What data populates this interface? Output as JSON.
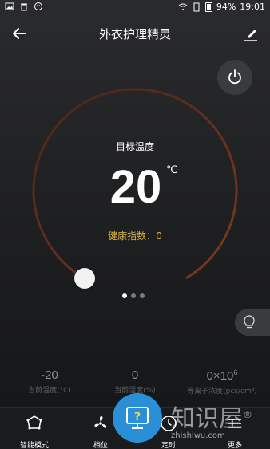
{
  "status_bar": {
    "battery": "94%",
    "time": "19:01"
  },
  "header": {
    "title": "外衣护理精灵"
  },
  "dial": {
    "label": "目标温度",
    "temperature": "20",
    "unit": "℃",
    "health_label": "健康指数：",
    "health_value": "0",
    "arc_color": "#6a2e1a"
  },
  "pager": {
    "count": 3,
    "active": 0
  },
  "stats": [
    {
      "value": "-20",
      "label": "当前温度(°C)"
    },
    {
      "value": "0",
      "label": "当前湿度(%)"
    },
    {
      "value": "0×10",
      "exp": "6",
      "label": "等离子浓度(pcs/cm³)"
    }
  ],
  "nav": [
    {
      "label": "智能模式",
      "icon": "smart-mode-icon"
    },
    {
      "label": "档位",
      "icon": "fan-icon"
    },
    {
      "label": "定时",
      "icon": "clock-icon"
    },
    {
      "label": "更多",
      "icon": "more-icon"
    }
  ],
  "watermark": {
    "text": "知识屋",
    "reg": "®",
    "sub": "zhishiwu.com"
  },
  "colors": {
    "accent_blue": "#2b8fd8",
    "health_gold": "#d9b74a"
  }
}
